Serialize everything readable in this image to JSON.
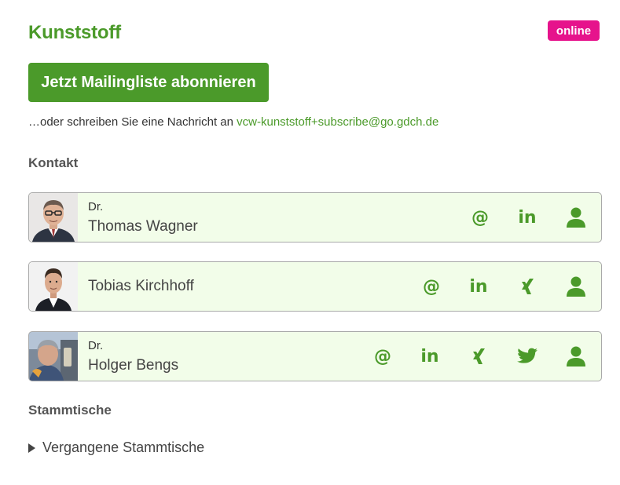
{
  "header": {
    "title": "Kunststoff",
    "status_badge": "online"
  },
  "subscribe": {
    "button_label": "Jetzt Mailingliste abonnieren",
    "alt_text": "…oder schreiben Sie eine Nachricht an",
    "email": "vcw-kunststoff+subscribe@go.gdch.de"
  },
  "sections": {
    "contact_heading": "Kontakt",
    "meetups_heading": "Stammtische",
    "past_meetups_label": "Vergangene Stammtische"
  },
  "contacts": [
    {
      "title": "Dr.",
      "name": "Thomas Wagner",
      "actions": [
        "email-icon",
        "linkedin-icon",
        "profile-icon"
      ]
    },
    {
      "title": "",
      "name": "Tobias Kirchhoff",
      "actions": [
        "email-icon",
        "linkedin-icon",
        "xing-icon",
        "profile-icon"
      ]
    },
    {
      "title": "Dr.",
      "name": "Holger Bengs",
      "actions": [
        "email-icon",
        "linkedin-icon",
        "xing-icon",
        "twitter-icon",
        "profile-icon"
      ]
    }
  ],
  "icons": {
    "email": "@",
    "linkedin": "in"
  },
  "colors": {
    "brand_green": "#4b9a2a",
    "badge_magenta": "#e6138c",
    "card_background": "#f2fde9"
  }
}
